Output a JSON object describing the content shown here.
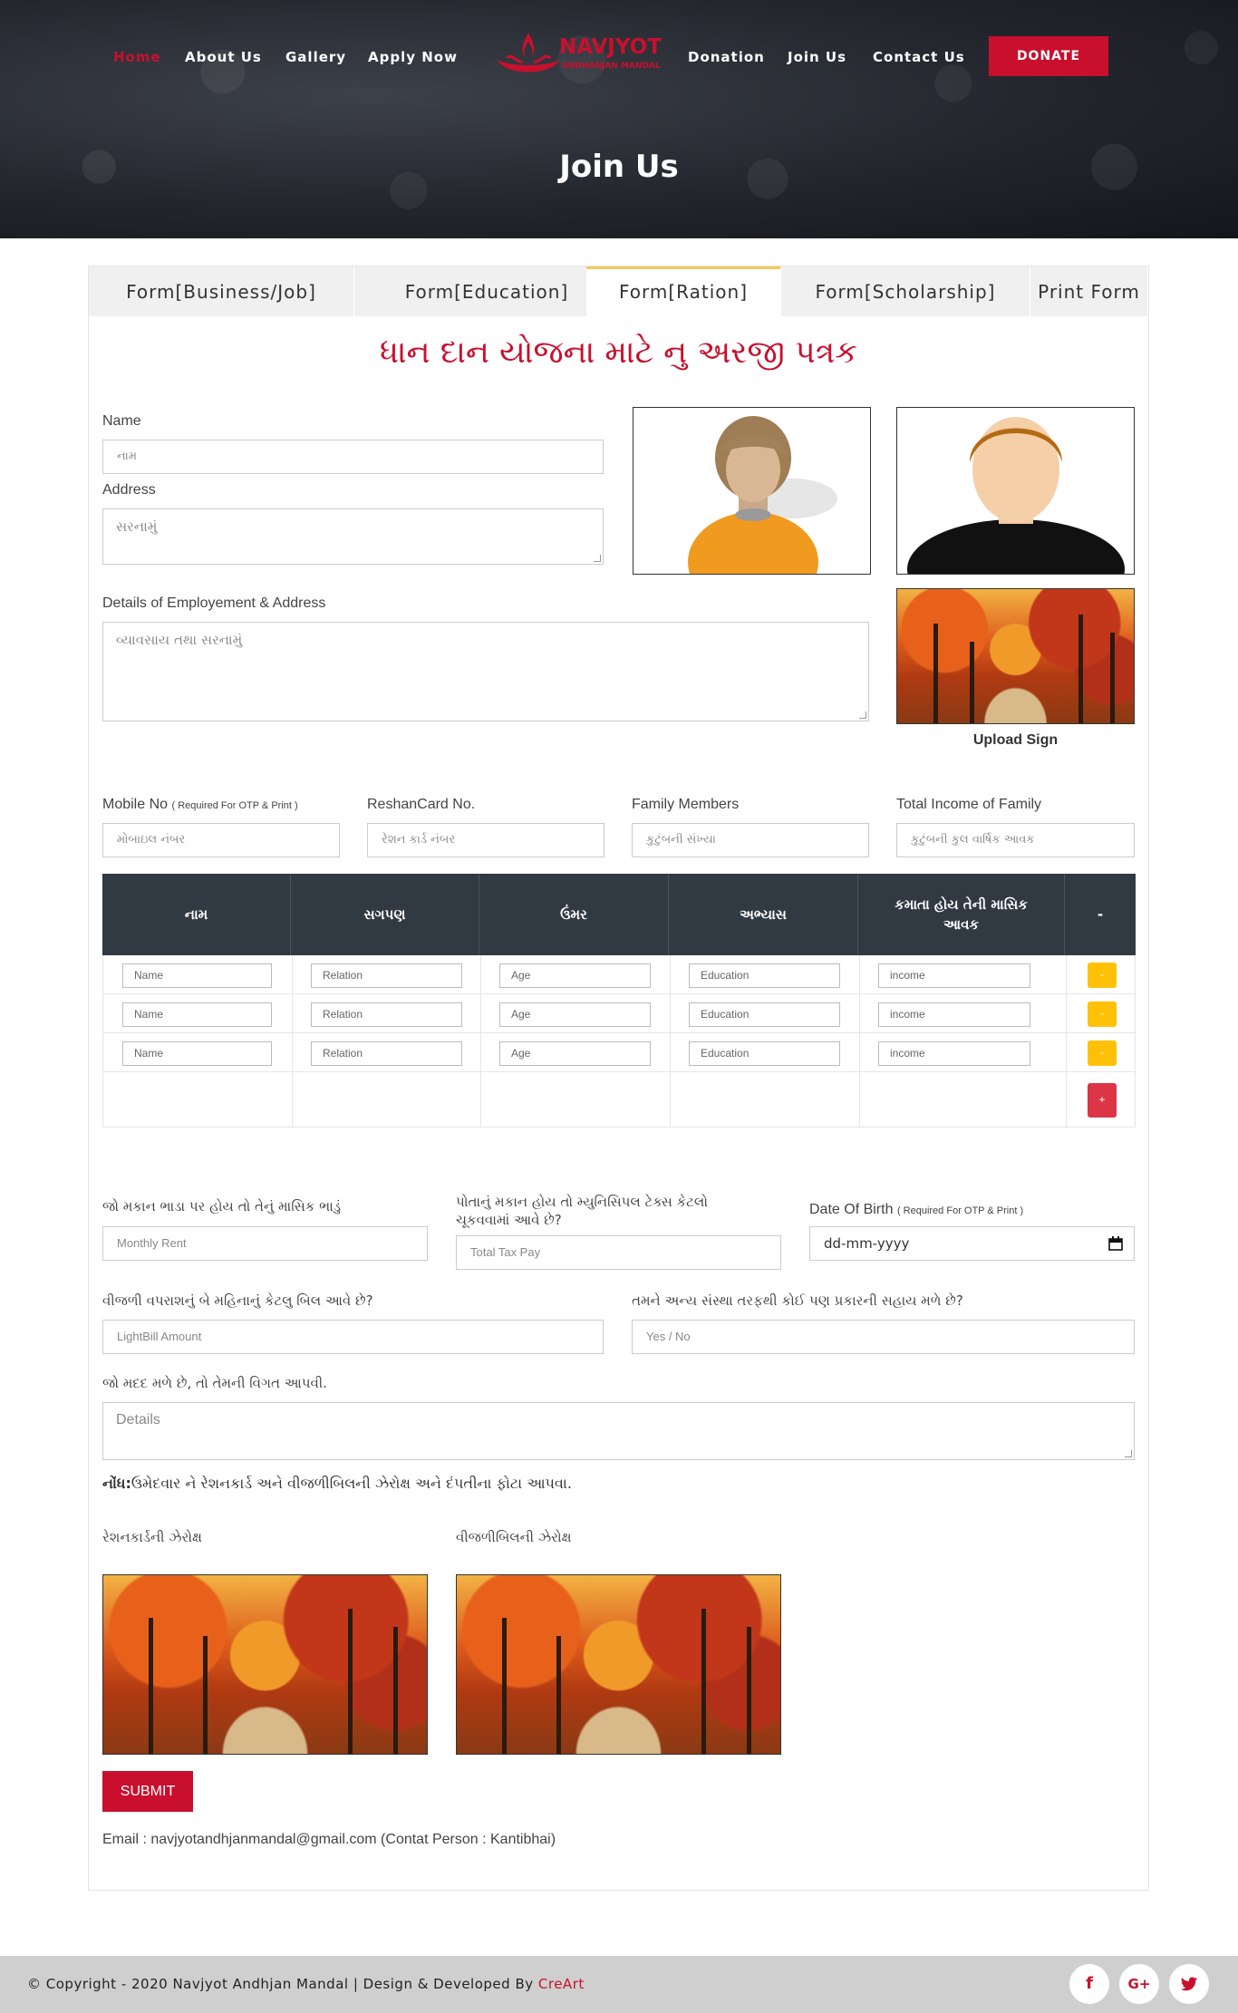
{
  "nav": {
    "items": [
      "Home",
      "About Us",
      "Gallery",
      "Apply Now",
      "Donation",
      "Join Us",
      "Contact Us"
    ],
    "active": "Home",
    "donate_label": "DONATE"
  },
  "logo": {
    "name": "NAVJYOT",
    "sub": "ANDHANJAN MANDAL"
  },
  "hero": {
    "title": "Join Us"
  },
  "tabs": [
    "Form[Business/Job]",
    "Form[Education]",
    "Form[Ration]",
    "Form[Scholarship]",
    "Print Form"
  ],
  "active_tab": "Form[Ration]",
  "form": {
    "heading": "ધાન દાન યોજના માટે નુ અરજી પત્રક",
    "name": {
      "label": "Name",
      "placeholder": "નામ"
    },
    "address": {
      "label": "Address",
      "placeholder": "સરનામું"
    },
    "employment": {
      "label": "Details of Employement & Address",
      "placeholder": "વ્યાવસાય તથા સરનામું"
    },
    "upload_sign": "Upload Sign",
    "mobile": {
      "label": "Mobile No",
      "note": "( Required For OTP & Print )",
      "placeholder": "મોબાઇલ નંબર"
    },
    "reshancard": {
      "label": "ReshanCard No.",
      "placeholder": "રેશન કાર્ડ નંબર"
    },
    "family_members": {
      "label": "Family Members",
      "placeholder": "કુટુંબની સંખ્યા"
    },
    "total_income": {
      "label": "Total Income of Family",
      "placeholder": "કુટુંબની કુલ વાર્ષિક આવક"
    },
    "table": {
      "headers": [
        "નામ",
        "સગપણ",
        "ઉંમર",
        "અભ્યાસ",
        "કમાતા હોય તેની માસિક આવક",
        "-"
      ],
      "row_placeholders": [
        "Name",
        "Relation",
        "Age",
        "Education",
        "income"
      ],
      "rows": 3,
      "remove_label": "-",
      "add_label": "+"
    },
    "rent": {
      "label": "જો મકાન ભાડા પર હોય તો તેનું માસિક ભાડું",
      "placeholder": "Monthly Rent"
    },
    "tax": {
      "label": "પોતાનું મકાન હોય તો મ્યુનિસિપલ ટેક્સ કેટલો ચૂકવવામાં આવે છે?",
      "placeholder": "Total Tax Pay"
    },
    "dob": {
      "label": "Date Of Birth",
      "note": "( Required For OTP & Print )",
      "placeholder": "dd-mm-yyyy"
    },
    "lightbill": {
      "label": "વીજળી વપરાશનું બે મહિનાનું કેટલુ બિલ આવે છે?",
      "placeholder": "LightBill Amount"
    },
    "help": {
      "label": "તમને અન્ય સંસ્થા તરફથી કોઈ પણ પ્રકારની સહાય મળે છે?",
      "placeholder": "Yes / No"
    },
    "help_details": {
      "label": "જો મદદ મળે છે, તો તેમની વિગત આપવી.",
      "placeholder": "Details"
    },
    "note_bold": "નોંધ:",
    "note_text": "ઉમેદવાર ને રેશનકાર્ડ અને વીજળીબિલની ઝેરોક્ષ અને દંપતીના ફોટા આપવા.",
    "ration_xerox": "રેશનકાર્ડની ઝેરોક્ષ",
    "bill_xerox": "વીજળીબિલની ઝેરોક્ષ",
    "submit": "SUBMIT",
    "email_line": "Email : navjyotandhjanmandal@gmail.com (Contat Person : Kantibhai)"
  },
  "footer": {
    "copyright": "© Copyright - 2020 Navjyot Andhjan Mandal | Design & Developed By ",
    "brand": "CreArt",
    "social": [
      "facebook-icon",
      "google-plus-icon",
      "twitter-icon"
    ]
  },
  "colors": {
    "accent": "#c8102e",
    "table_head": "#313943",
    "remove_btn": "#ffc107",
    "add_btn": "#dc3545"
  }
}
